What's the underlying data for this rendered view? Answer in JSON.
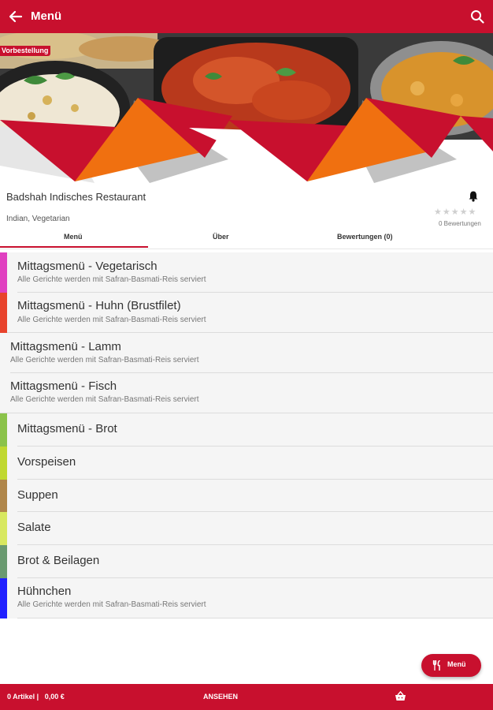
{
  "appbar": {
    "title": "Menü"
  },
  "hero": {
    "badge": "Vorbestellung"
  },
  "restaurant": {
    "name": "Badshah Indisches Restaurant",
    "cuisine": "Indian, Vegetarian",
    "stars": "★★★★★",
    "rating_count": "0 Bewertungen"
  },
  "tabs": [
    {
      "label": "Menü",
      "active": true
    },
    {
      "label": "Über",
      "active": false
    },
    {
      "label": "Bewertungen (0)",
      "active": false
    }
  ],
  "categories": [
    {
      "name": "Mittagsmenü - Vegetarisch",
      "desc": "Alle Gerichte werden mit Safran-Basmati-Reis serviert",
      "color": "#e040c0"
    },
    {
      "name": "Mittagsmenü - Huhn (Brustfilet)",
      "desc": "Alle Gerichte werden mit Safran-Basmati-Reis serviert",
      "color": "#e8432c"
    },
    {
      "name": "Mittagsmenü - Lamm",
      "desc": "Alle Gerichte werden mit Safran-Basmati-Reis serviert",
      "color": ""
    },
    {
      "name": "Mittagsmenü - Fisch",
      "desc": "Alle Gerichte werden mit Safran-Basmati-Reis serviert",
      "color": ""
    },
    {
      "name": "Mittagsmenü - Brot",
      "desc": "",
      "color": "#8bc34a"
    },
    {
      "name": "Vorspeisen",
      "desc": "",
      "color": "#c0d830"
    },
    {
      "name": "Suppen",
      "desc": "",
      "color": "#b0864a"
    },
    {
      "name": "Salate",
      "desc": "",
      "color": "#d8e860"
    },
    {
      "name": "Brot & Beilagen",
      "desc": "",
      "color": "#6a9a70"
    },
    {
      "name": "Hühnchen",
      "desc": "Alle Gerichte werden mit Safran-Basmati-Reis serviert",
      "color": "#2020ff"
    }
  ],
  "fab": {
    "label": "Menü"
  },
  "bottombar": {
    "cart": "0 Artikel |   0,00 €",
    "view": "ANSEHEN"
  },
  "colors": {
    "brand": "#c8102e",
    "orange": "#f07010"
  },
  "icons": [
    "back-arrow-icon",
    "search-icon",
    "bell-icon",
    "fork-knife-icon",
    "basket-icon"
  ]
}
